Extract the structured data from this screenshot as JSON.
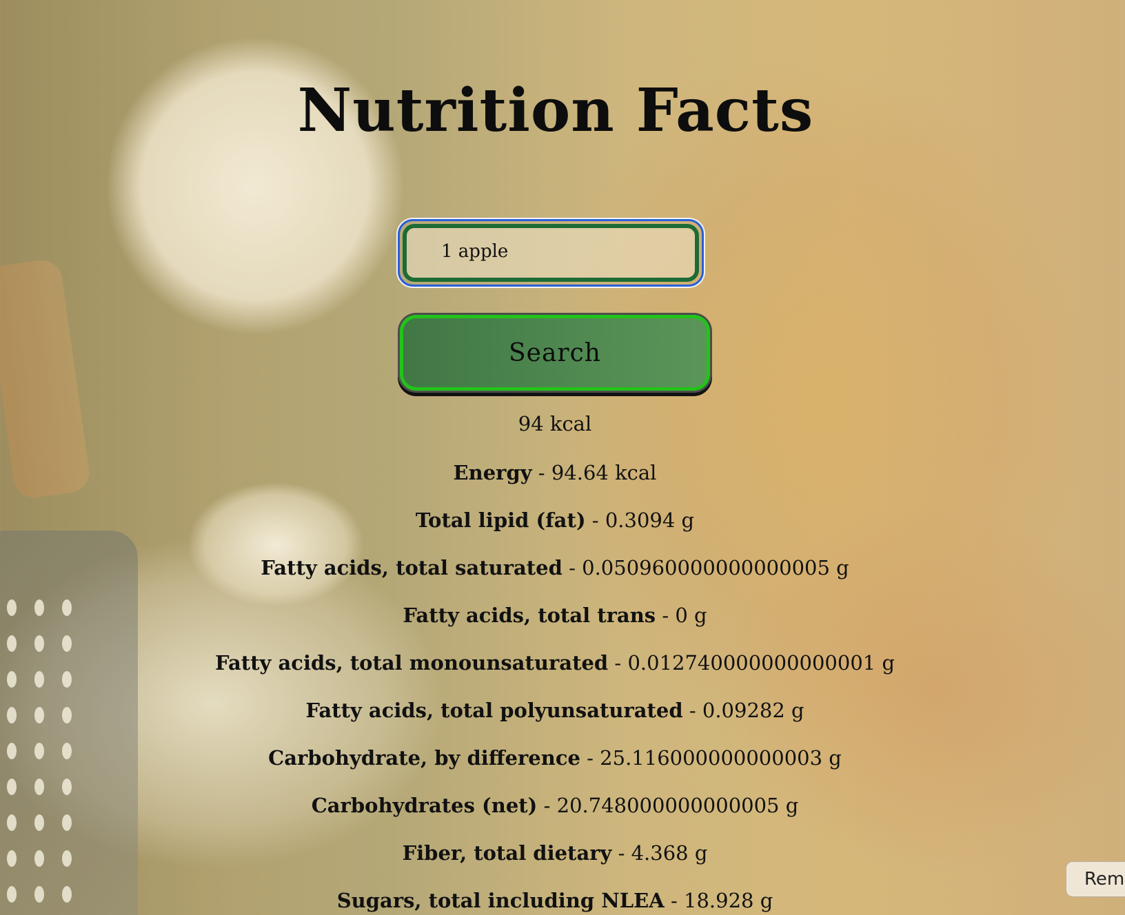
{
  "page": {
    "title": "Nutrition Facts"
  },
  "search": {
    "value": "1 apple",
    "button_label": "Search"
  },
  "result": {
    "calories": "94 kcal",
    "nutrients": [
      {
        "name": "Energy",
        "value": " - 94.64 kcal"
      },
      {
        "name": "Total lipid (fat)",
        "value": " - 0.3094 g"
      },
      {
        "name": "Fatty acids, total saturated",
        "value": " - 0.050960000000000005 g"
      },
      {
        "name": "Fatty acids, total trans",
        "value": " - 0 g"
      },
      {
        "name": "Fatty acids, total monounsaturated",
        "value": " - 0.012740000000000001 g"
      },
      {
        "name": "Fatty acids, total polyunsaturated",
        "value": " - 0.09282 g"
      },
      {
        "name": "Carbohydrate, by difference",
        "value": " - 25.116000000000003 g"
      },
      {
        "name": "Carbohydrates (net)",
        "value": " - 20.748000000000005 g"
      },
      {
        "name": "Fiber, total dietary",
        "value": " - 4.368 g"
      },
      {
        "name": "Sugars, total including NLEA",
        "value": " - 18.928 g"
      }
    ]
  },
  "corner_tab": {
    "label": "Remi"
  },
  "colors": {
    "input_border": "#1d6b35",
    "input_focus_ring": "#2a5fd8",
    "button_border": "#22c31a",
    "button_fill": "#3f7f4b"
  }
}
